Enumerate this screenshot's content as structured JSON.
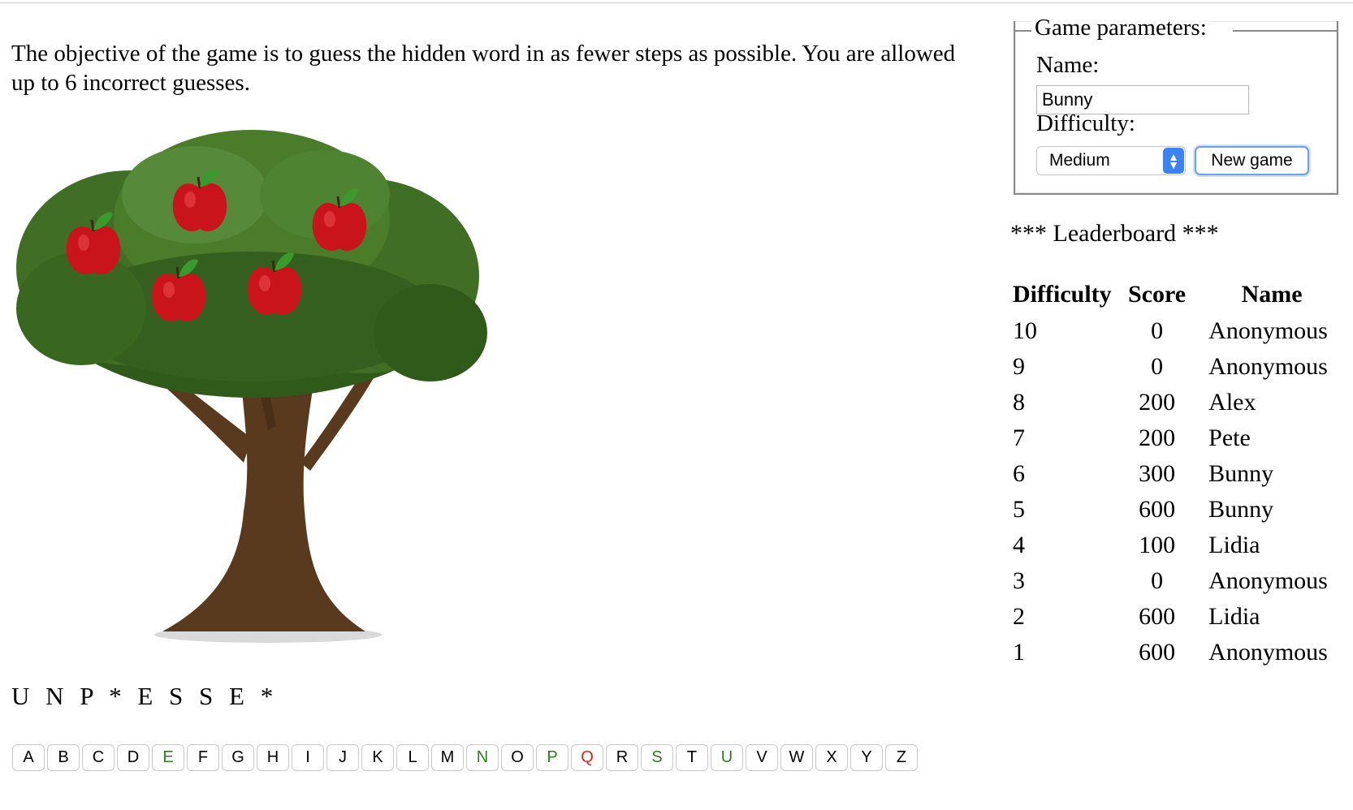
{
  "objective": "The objective of the game is to guess the hidden word in as fewer steps as possible. You are allowed up to 6 incorrect guesses.",
  "word_display": "U N P * E S S E *",
  "letters": [
    {
      "letter": "A",
      "state": "unused"
    },
    {
      "letter": "B",
      "state": "unused"
    },
    {
      "letter": "C",
      "state": "unused"
    },
    {
      "letter": "D",
      "state": "unused"
    },
    {
      "letter": "E",
      "state": "correct"
    },
    {
      "letter": "F",
      "state": "unused"
    },
    {
      "letter": "G",
      "state": "unused"
    },
    {
      "letter": "H",
      "state": "unused"
    },
    {
      "letter": "I",
      "state": "unused"
    },
    {
      "letter": "J",
      "state": "unused"
    },
    {
      "letter": "K",
      "state": "unused"
    },
    {
      "letter": "L",
      "state": "unused"
    },
    {
      "letter": "M",
      "state": "unused"
    },
    {
      "letter": "N",
      "state": "correct"
    },
    {
      "letter": "O",
      "state": "unused"
    },
    {
      "letter": "P",
      "state": "correct"
    },
    {
      "letter": "Q",
      "state": "incorrect"
    },
    {
      "letter": "R",
      "state": "unused"
    },
    {
      "letter": "S",
      "state": "correct"
    },
    {
      "letter": "T",
      "state": "unused"
    },
    {
      "letter": "U",
      "state": "correct"
    },
    {
      "letter": "V",
      "state": "unused"
    },
    {
      "letter": "W",
      "state": "unused"
    },
    {
      "letter": "X",
      "state": "unused"
    },
    {
      "letter": "Y",
      "state": "unused"
    },
    {
      "letter": "Z",
      "state": "unused"
    }
  ],
  "apples_remaining": 5,
  "params": {
    "legend": "Game parameters:",
    "name_label": "Name:",
    "name_value": "Bunny",
    "difficulty_label": "Difficulty:",
    "difficulty_value": "Medium",
    "new_game_label": "New game"
  },
  "leaderboard": {
    "title": "*** Leaderboard ***",
    "headers": [
      "Difficulty",
      "Score",
      "Name"
    ],
    "rows": [
      {
        "difficulty": "10",
        "score": "0",
        "name": "Anonymous"
      },
      {
        "difficulty": "9",
        "score": "0",
        "name": "Anonymous"
      },
      {
        "difficulty": "8",
        "score": "200",
        "name": "Alex"
      },
      {
        "difficulty": "7",
        "score": "200",
        "name": "Pete"
      },
      {
        "difficulty": "6",
        "score": "300",
        "name": "Bunny"
      },
      {
        "difficulty": "5",
        "score": "600",
        "name": "Bunny"
      },
      {
        "difficulty": "4",
        "score": "100",
        "name": "Lidia"
      },
      {
        "difficulty": "3",
        "score": "0",
        "name": "Anonymous"
      },
      {
        "difficulty": "2",
        "score": "600",
        "name": "Lidia"
      },
      {
        "difficulty": "1",
        "score": "600",
        "name": "Anonymous"
      }
    ]
  },
  "colors": {
    "correct": "#2e7d1e",
    "incorrect": "#e0241a",
    "accent": "#3b82f6",
    "apple": "#c8141a",
    "leaf": "#3f6e24",
    "trunk": "#5a3a1e"
  }
}
